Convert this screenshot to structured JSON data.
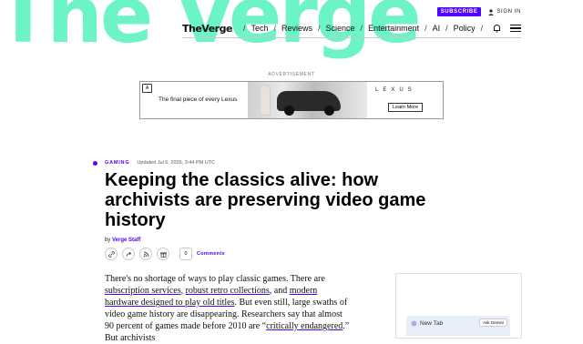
{
  "brand": {
    "background_logo": "The Verge",
    "nav_logo": "TheVerge"
  },
  "topbar": {
    "subscribe": "SUBSCRIBE",
    "signin": "SIGN IN"
  },
  "nav": {
    "items": [
      "Tech",
      "Reviews",
      "Science",
      "Entertainment",
      "AI",
      "Policy"
    ]
  },
  "ad": {
    "label": "ADVERTISEMENT",
    "tag": "A",
    "text": "The final piece of every Lexus",
    "brand": "LEXUS",
    "cta": "Learn More"
  },
  "article": {
    "kicker": "GAMING",
    "date": "Updated Jul 6, 2026, 3:44 PM UTC",
    "headline": "Keeping the classics alive: how archivists are preserving video game history",
    "byline_prefix": "by",
    "author": "Verge Staff",
    "comment_count": "0",
    "comments_label": "Comments",
    "body": {
      "p1": "There's no shortage of ways to play classic games. There are ",
      "link1": "subscription services",
      "p2": ", ",
      "link2": "robust retro collections",
      "p3": ", and ",
      "link3": "modern hardware designed to play old titles",
      "p4": ". But even still, large swaths of video game history are disappearing. Researchers say that almost 90 percent of games made before 2010 are “",
      "link4": "critically endangered",
      "p5": ".” But archivists"
    }
  },
  "sidebar": {
    "newtab": "New Tab",
    "ask": "Ask Gemini"
  },
  "colors": {
    "accent": "#5200ff",
    "logo_bg": "#5ef2c3"
  }
}
